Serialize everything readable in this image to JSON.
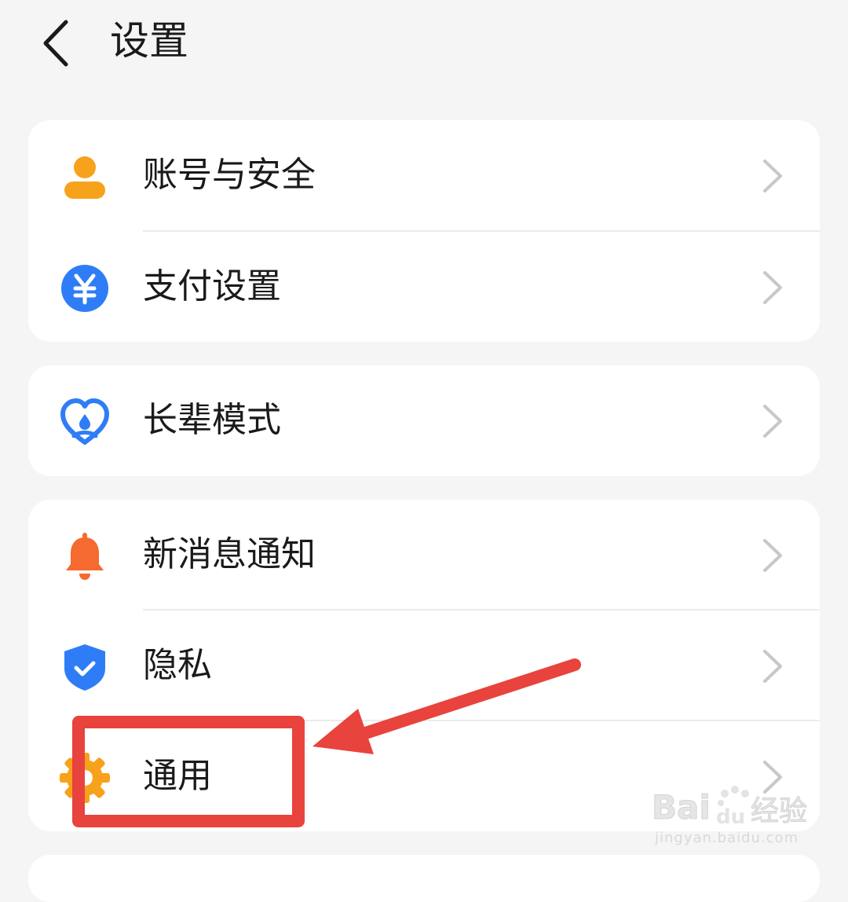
{
  "header": {
    "title": "设置"
  },
  "cards": [
    {
      "items": [
        {
          "label": "账号与安全",
          "icon": "account-person-icon",
          "color": "#f7a21b"
        },
        {
          "label": "支付设置",
          "icon": "payment-yuan-icon",
          "color": "#2f7df6"
        }
      ]
    },
    {
      "items": [
        {
          "label": "长辈模式",
          "icon": "elder-heart-icon",
          "color": "#2f7df6"
        }
      ]
    },
    {
      "items": [
        {
          "label": "新消息通知",
          "icon": "bell-icon",
          "color": "#f46a2f"
        },
        {
          "label": "隐私",
          "icon": "privacy-shield-icon",
          "color": "#2f7df6"
        },
        {
          "label": "通用",
          "icon": "gear-icon",
          "color": "#f7a21b"
        }
      ]
    }
  ],
  "annotation": {
    "color": "#e8433d"
  },
  "watermark": {
    "brand": "Bai",
    "brand_du": "du",
    "brand_suffix": "经验",
    "url": "jingyan.baidu.com"
  }
}
